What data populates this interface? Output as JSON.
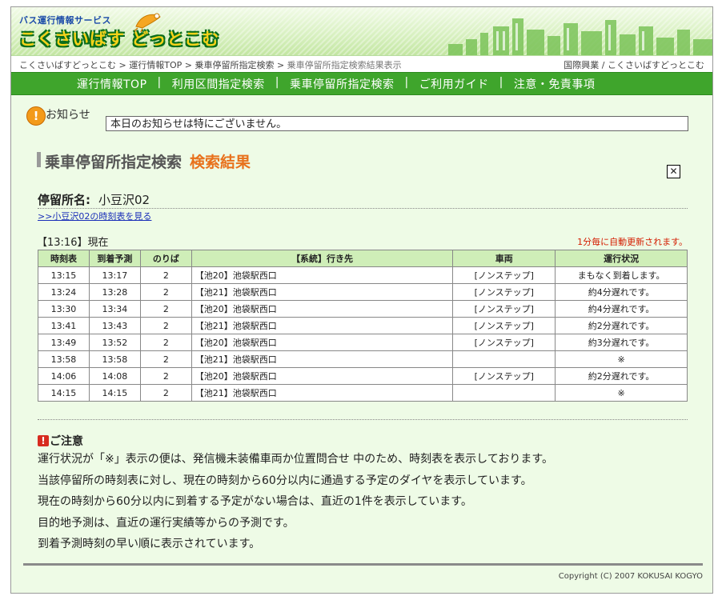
{
  "header": {
    "logo_sub": "バス運行情報サービス",
    "logo_main": "こくさいばす どっとこむ"
  },
  "breadcrumb": {
    "items": [
      "こくさいばすどっとこむ",
      "運行情報TOP",
      "乗車停留所指定検索",
      "乗車停留所指定検索結果表示"
    ],
    "separator": " > ",
    "org": "国際興業 / こくさいばすどっとこむ"
  },
  "nav": {
    "items": [
      "運行情報TOP",
      "利用区間指定検索",
      "乗車停留所指定検索",
      "ご利用ガイド",
      "注意・免責事項"
    ],
    "separator": "|"
  },
  "notice": {
    "icon": "exclamation-circle-icon",
    "label": "お知らせ",
    "text": "本日のお知らせは特にございません。"
  },
  "page": {
    "title": "乗車停留所指定検索",
    "title_result": "検索結果",
    "stop_label": "停留所名:",
    "stop_name": "小豆沢02",
    "timetable_link": ">>小豆沢02の時刻表を見る",
    "current_time": "【13:16】現在",
    "auto_refresh": "1分毎に自動更新されます。"
  },
  "table": {
    "headers": [
      "時刻表",
      "到着予測",
      "のりば",
      "【系統】行き先",
      "車両",
      "運行状況"
    ],
    "rows": [
      [
        "13:15",
        "13:17",
        "2",
        "【池20】池袋駅西口",
        "[ノンステップ]",
        "まもなく到着します。"
      ],
      [
        "13:24",
        "13:28",
        "2",
        "【池21】池袋駅西口",
        "[ノンステップ]",
        "約4分遅れです。"
      ],
      [
        "13:30",
        "13:34",
        "2",
        "【池20】池袋駅西口",
        "[ノンステップ]",
        "約4分遅れです。"
      ],
      [
        "13:41",
        "13:43",
        "2",
        "【池21】池袋駅西口",
        "[ノンステップ]",
        "約2分遅れです。"
      ],
      [
        "13:49",
        "13:52",
        "2",
        "【池20】池袋駅西口",
        "[ノンステップ]",
        "約3分遅れです。"
      ],
      [
        "13:58",
        "13:58",
        "2",
        "【池21】池袋駅西口",
        "",
        "※"
      ],
      [
        "14:06",
        "14:08",
        "2",
        "【池20】池袋駅西口",
        "[ノンステップ]",
        "約2分遅れです。"
      ],
      [
        "14:15",
        "14:15",
        "2",
        "【池21】池袋駅西口",
        "",
        "※"
      ]
    ]
  },
  "caution": {
    "icon": "exclamation-square-icon",
    "label": "ご注意",
    "notes": [
      "運行状況が「※」表示の便は、発信機未装備車両か位置問合せ 中のため、時刻表を表示しております。",
      "当該停留所の時刻表に対し、現在の時刻から60分以内に通過する予定のダイヤを表示しています。",
      "現在の時刻から60分以内に到着する予定がない場合は、直近の1件を表示しています。",
      "目的地予測は、直近の運行実績等からの予測です。",
      "到着予測時刻の早い順に表示されています。"
    ]
  },
  "footer": {
    "copyright": "Copyright (C) 2007 KOKUSAI KOGYO"
  },
  "colors": {
    "nav_green": "#3fa52c",
    "background": "#eefbe6",
    "header_row": "#cfeeb8",
    "accent_orange": "#e8711c",
    "alert_red": "#d41c00"
  }
}
